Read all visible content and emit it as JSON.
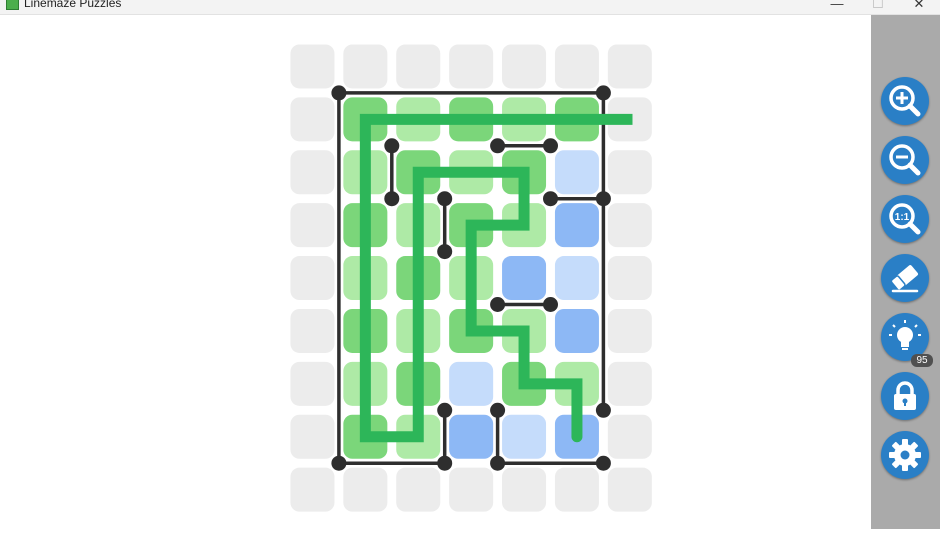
{
  "window": {
    "title": "Linemaze Puzzles",
    "minimize_glyph": "—",
    "maximize_glyph": "☐",
    "close_glyph": "✕"
  },
  "puzzle": {
    "grid_cols": 7,
    "grid_rows": 9,
    "cell_state": [
      [
        "empty",
        "empty",
        "empty",
        "empty",
        "empty",
        "empty",
        "empty"
      ],
      [
        "empty",
        "green",
        "lightgreen",
        "green",
        "lightgreen",
        "green",
        "empty"
      ],
      [
        "empty",
        "lightgreen",
        "green",
        "lightgreen",
        "green",
        "lightblue",
        "empty"
      ],
      [
        "empty",
        "green",
        "lightgreen",
        "green",
        "lightgreen",
        "blue",
        "empty"
      ],
      [
        "empty",
        "lightgreen",
        "green",
        "lightgreen",
        "blue",
        "lightblue",
        "empty"
      ],
      [
        "empty",
        "green",
        "lightgreen",
        "green",
        "lightgreen",
        "blue",
        "empty"
      ],
      [
        "empty",
        "lightgreen",
        "green",
        "lightblue",
        "green",
        "lightgreen",
        "empty"
      ],
      [
        "empty",
        "green",
        "lightgreen",
        "blue",
        "lightblue",
        "blue",
        "empty"
      ],
      [
        "empty",
        "empty",
        "empty",
        "empty",
        "empty",
        "empty",
        "empty"
      ]
    ],
    "walls": [
      [
        [
          1,
          1
        ],
        [
          6,
          1
        ]
      ],
      [
        [
          1,
          1
        ],
        [
          1,
          8
        ]
      ],
      [
        [
          1,
          8
        ],
        [
          3,
          8
        ]
      ],
      [
        [
          3,
          8
        ],
        [
          3,
          7
        ]
      ],
      [
        [
          4,
          7
        ],
        [
          4,
          8
        ]
      ],
      [
        [
          4,
          8
        ],
        [
          6,
          8
        ]
      ],
      [
        [
          6,
          1
        ],
        [
          6,
          7
        ]
      ],
      [
        [
          2,
          2
        ],
        [
          2,
          3
        ]
      ],
      [
        [
          4,
          2
        ],
        [
          5,
          2
        ]
      ],
      [
        [
          5,
          3
        ],
        [
          6,
          3
        ]
      ],
      [
        [
          3,
          3
        ],
        [
          3,
          4
        ]
      ],
      [
        [
          4,
          5
        ],
        [
          5,
          5
        ]
      ]
    ],
    "player_path": [
      [
        1.5,
        1.5
      ],
      [
        6.55,
        1.5
      ],
      [
        1.5,
        1.5
      ],
      [
        1.5,
        7.5
      ],
      [
        2.5,
        7.5
      ],
      [
        2.5,
        2.5
      ],
      [
        4.5,
        2.5
      ],
      [
        4.5,
        3.5
      ],
      [
        3.5,
        3.5
      ],
      [
        3.5,
        5.5
      ],
      [
        4.5,
        5.5
      ],
      [
        4.5,
        6.5
      ],
      [
        5.5,
        6.5
      ],
      [
        5.5,
        7.5
      ]
    ],
    "colors": {
      "empty": "#ececec",
      "green": "#7bd67a",
      "lightgreen": "#aeeaa6",
      "blue": "#8db8f5",
      "lightblue": "#c5dcfb",
      "wall": "#2e2e2e",
      "path": "#2db659"
    }
  },
  "toolbar": {
    "zoom_in_icon": "zoom-in-icon",
    "zoom_out_icon": "zoom-out-icon",
    "zoom_reset_icon": "zoom-reset-icon",
    "zoom_reset_label": "1:1",
    "eraser_icon": "eraser-icon",
    "hint_icon": "lightbulb-icon",
    "hint_count": "95",
    "lock_icon": "lock-icon",
    "settings_icon": "gear-icon",
    "button_color": "#2a7fc6"
  }
}
